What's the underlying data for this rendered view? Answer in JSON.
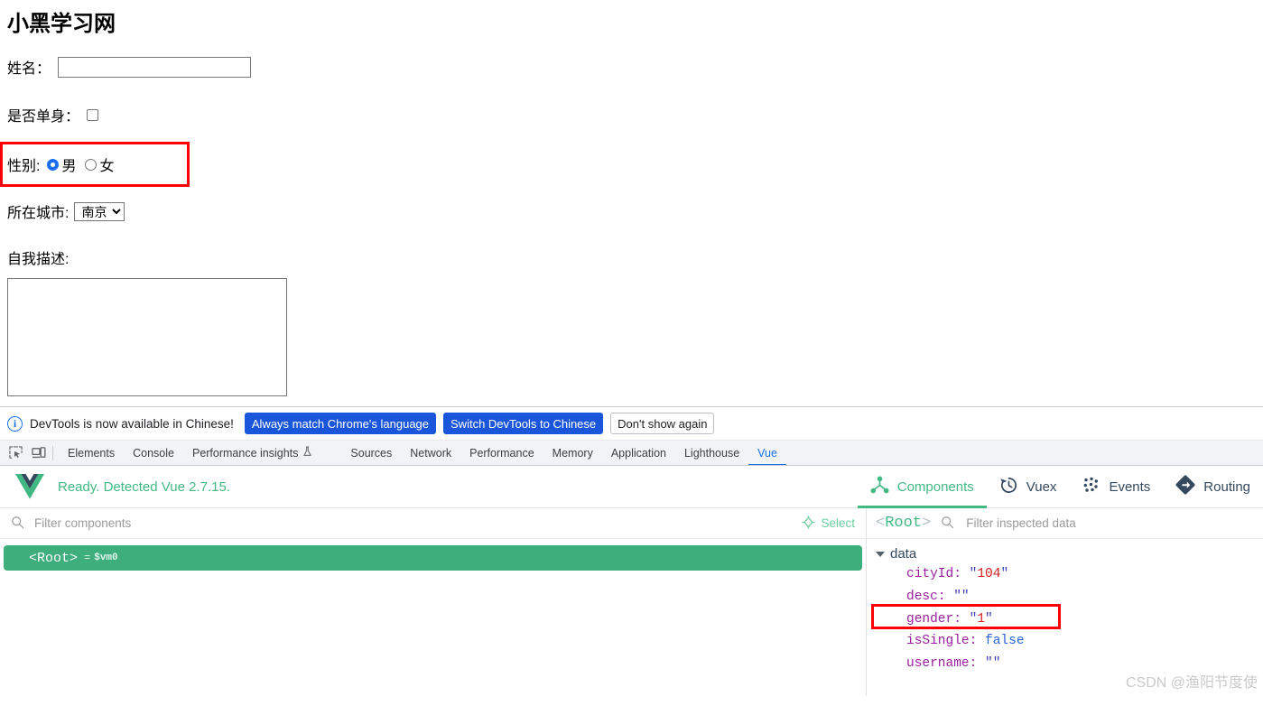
{
  "page": {
    "title": "小黑学习网",
    "fields": {
      "name_label": "姓名：",
      "name_value": "",
      "single_label": "是否单身：",
      "gender_label": "性别:",
      "gender_male": "男",
      "gender_female": "女",
      "city_label": "所在城市:",
      "city_value": "南京",
      "city_options": [
        "南京"
      ],
      "desc_label": "自我描述:",
      "desc_value": ""
    },
    "annotation_color": "#fb0007"
  },
  "devtools": {
    "notice": {
      "icon": "info-icon",
      "message": "DevTools is now available in Chinese!",
      "btn_always_match": "Always match Chrome's language",
      "btn_switch": "Switch DevTools to Chinese",
      "btn_dismiss": "Don't show again"
    },
    "toolbar_icons": [
      "inspect-element-icon",
      "device-toolbar-icon"
    ],
    "tabs": [
      {
        "label": "Elements",
        "active": false
      },
      {
        "label": "Console",
        "active": false
      },
      {
        "label": "Performance insights",
        "active": false,
        "badge": "flask-icon"
      },
      {
        "label": "Sources",
        "active": false
      },
      {
        "label": "Network",
        "active": false
      },
      {
        "label": "Performance",
        "active": false
      },
      {
        "label": "Memory",
        "active": false
      },
      {
        "label": "Application",
        "active": false
      },
      {
        "label": "Lighthouse",
        "active": false
      },
      {
        "label": "Vue",
        "active": true
      }
    ],
    "accent_blue": "#1a73e8"
  },
  "vue_panel": {
    "status": "Ready. Detected Vue 2.7.15.",
    "logo": "vue-logo-icon",
    "accent_green": "#42b883",
    "tabs": [
      {
        "label": "Components",
        "icon": "components-icon",
        "active": true
      },
      {
        "label": "Vuex",
        "icon": "history-icon",
        "active": false
      },
      {
        "label": "Events",
        "icon": "events-dots-icon",
        "active": false
      },
      {
        "label": "Routing",
        "icon": "routing-arrow-icon",
        "active": false
      }
    ],
    "components_pane": {
      "filter_placeholder": "Filter components",
      "filter_value": "",
      "select_label": "Select",
      "select_icon": "target-icon",
      "tree": [
        {
          "tag": "<Root>",
          "eq": "=",
          "instance": "$vm0",
          "selected": true
        }
      ]
    },
    "inspector_pane": {
      "breadcrumb_open": "<",
      "breadcrumb_name": "Root",
      "breadcrumb_close": ">",
      "filter_placeholder": "Filter inspected data",
      "filter_value": "",
      "group_label": "data",
      "group_expanded": true,
      "entries": [
        {
          "key": "cityId",
          "value": "104",
          "type": "string",
          "highlighted": false
        },
        {
          "key": "desc",
          "value": "",
          "type": "string",
          "highlighted": false
        },
        {
          "key": "gender",
          "value": "1",
          "type": "string",
          "highlighted": true
        },
        {
          "key": "isSingle",
          "value": "false",
          "type": "boolean",
          "highlighted": false
        },
        {
          "key": "username",
          "value": "",
          "type": "string",
          "highlighted": false
        }
      ]
    }
  },
  "watermark": "CSDN @渔阳节度使"
}
